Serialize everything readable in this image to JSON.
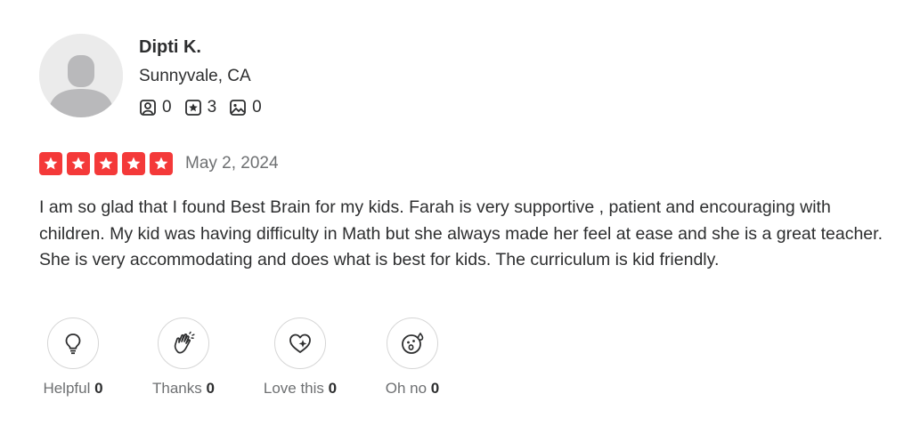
{
  "reviewer": {
    "name": "Dipti K.",
    "location": "Sunnyvale, CA",
    "stats": {
      "friends": "0",
      "reviews": "3",
      "photos": "0"
    }
  },
  "review": {
    "rating": 5,
    "date": "May 2, 2024",
    "text": "I am so glad that I found Best Brain for my kids. Farah is very supportive , patient and encouraging with children. My kid was having difficulty in Math but she always made her feel at ease and she is a great teacher. She is very accommodating and does what is best for kids. The curriculum is kid friendly."
  },
  "reactions": [
    {
      "label": "Helpful",
      "count": "0",
      "icon": "lightbulb-icon"
    },
    {
      "label": "Thanks",
      "count": "0",
      "icon": "clapping-hands-icon"
    },
    {
      "label": "Love this",
      "count": "0",
      "icon": "heart-sparkle-icon"
    },
    {
      "label": "Oh no",
      "count": "0",
      "icon": "shocked-face-icon"
    }
  ],
  "colors": {
    "star": "#f43939",
    "text": "#2d2e2f",
    "muted": "#6e7072"
  }
}
